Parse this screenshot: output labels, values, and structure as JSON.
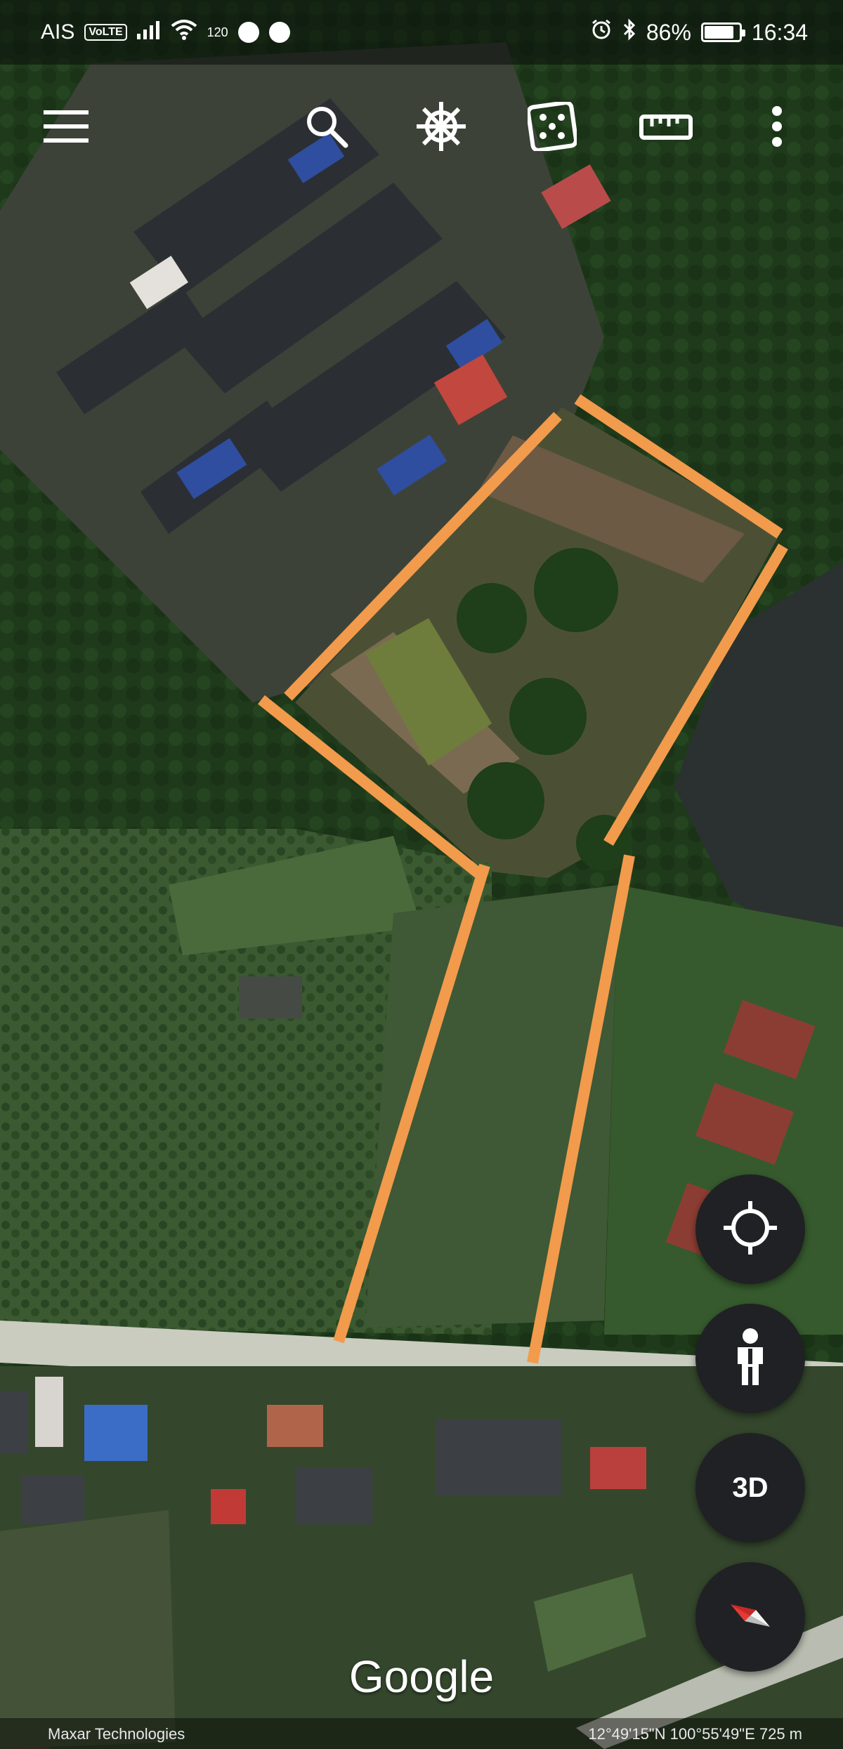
{
  "status_bar": {
    "carrier": "AIS",
    "volte_badge": "VoLTE",
    "net_speed": "120",
    "battery_percent_text": "86%",
    "battery_level": 0.86,
    "time": "16:34"
  },
  "toolbar": {
    "icons": [
      "menu-icon",
      "search-icon",
      "voyager-ship-wheel-icon",
      "feeling-lucky-dice-icon",
      "measure-ruler-icon",
      "more-options-icon"
    ]
  },
  "controls": {
    "my_location_icon": "crosshair-icon",
    "street_view_icon": "pegman-icon",
    "view_3d_label": "3D",
    "compass_icon": "compass-icon"
  },
  "map": {
    "logo": "Google",
    "attribution": "Maxar Technologies",
    "coordinates": "12°49'15\"N 100°55'49\"E 725 m"
  },
  "colors": {
    "parcel_outline": "#f29b4c",
    "fab_background": "#202124",
    "road": "#c9ccbf",
    "vegetation_dark": "#1f3a1c",
    "vegetation_mid": "#2f5128"
  }
}
